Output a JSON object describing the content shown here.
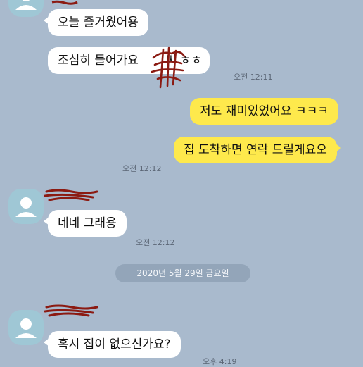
{
  "messages": [
    {
      "side": "received",
      "text": "오늘 즐거웠어용"
    },
    {
      "side": "received",
      "text": "조심히 들어가요",
      "suffix": "씨 ㅎㅎ",
      "time": "오전 12:11"
    },
    {
      "side": "sent",
      "text": "저도 재미있었어요 ㅋㅋㅋ"
    },
    {
      "side": "sent",
      "text": "집 도착하면 연락 드릴게요오",
      "time": "오전 12:12"
    },
    {
      "side": "received",
      "text": "네네 그래용",
      "time": "오전 12:12"
    },
    {
      "side": "received",
      "text": "혹시 집이 없으신가요?",
      "time": "오후 4:19"
    }
  ],
  "date_divider": "2020년 5월 29일 금요일",
  "icons": {
    "avatar": "default-profile-icon",
    "redaction": "red-scribble"
  },
  "colors": {
    "background": "#a9bacd",
    "received_bubble": "#ffffff",
    "sent_bubble": "#fee94c",
    "avatar": "#9fc7d5",
    "redaction": "#8b1a12"
  }
}
